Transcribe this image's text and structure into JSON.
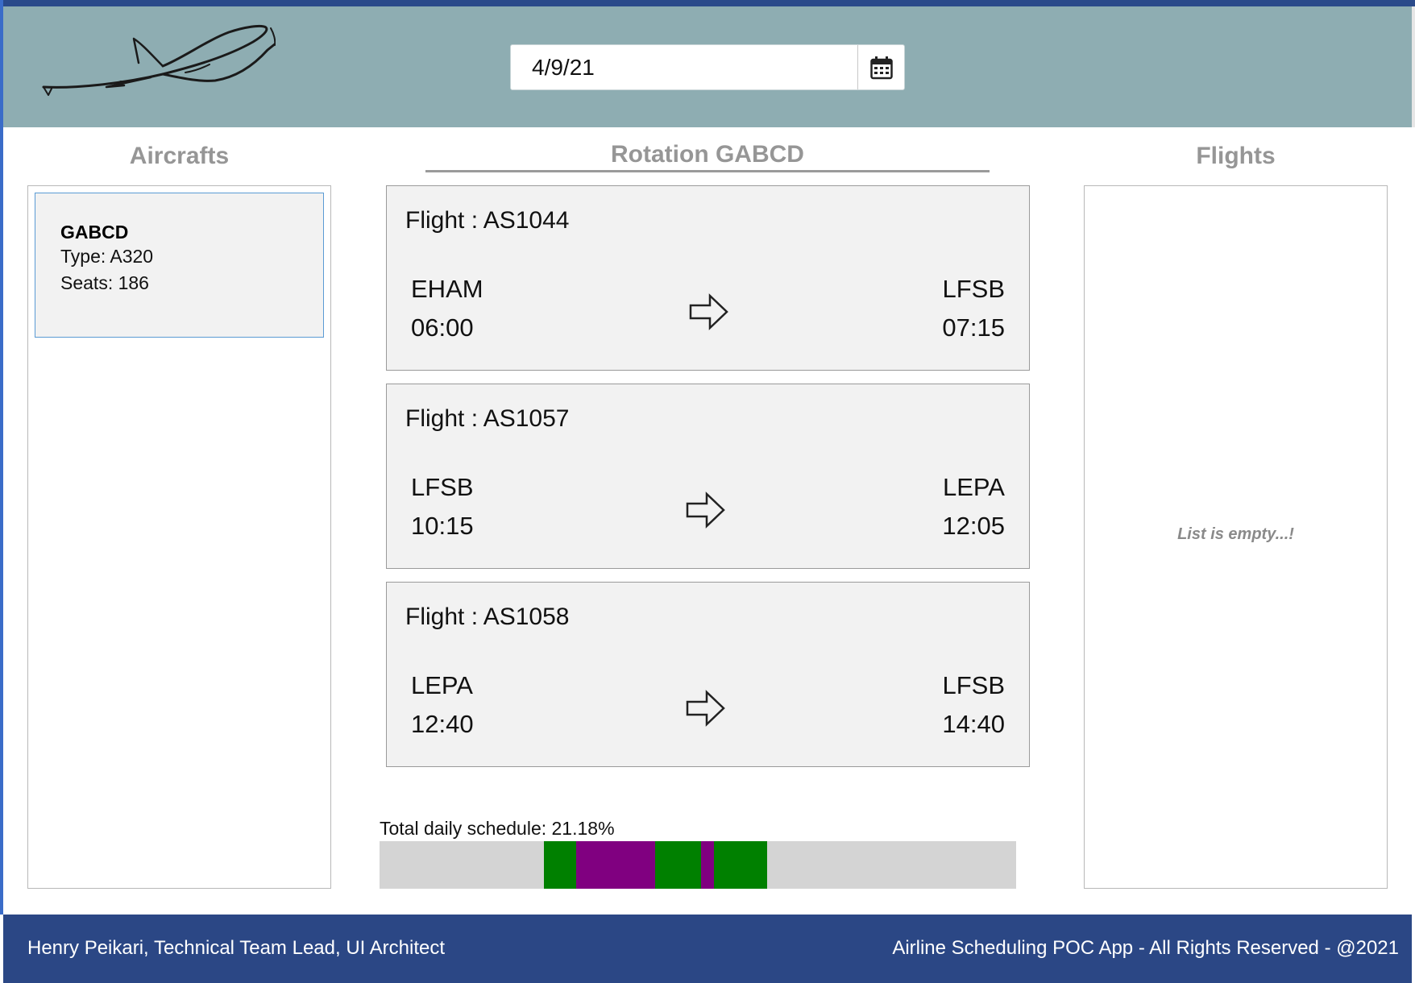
{
  "header": {
    "date_value": "4/9/21",
    "logo_icon": "airplane-logo-icon",
    "calendar_icon": "calendar-icon"
  },
  "aircrafts": {
    "title": "Aircrafts",
    "items": [
      {
        "registration": "GABCD",
        "type_text": "Type: A320",
        "seats_text": "Seats: 186"
      }
    ]
  },
  "rotation": {
    "title": "Rotation GABCD",
    "flights": [
      {
        "title": "Flight : AS1044",
        "origin": "EHAM",
        "departure": "06:00",
        "destination": "LFSB",
        "arrival": "07:15"
      },
      {
        "title": "Flight : AS1057",
        "origin": "LFSB",
        "departure": "10:15",
        "destination": "LEPA",
        "arrival": "12:05"
      },
      {
        "title": "Flight : AS1058",
        "origin": "LEPA",
        "departure": "12:40",
        "destination": "LFSB",
        "arrival": "14:40"
      }
    ],
    "arrow_icon": "right-arrow-icon"
  },
  "schedule": {
    "label": "Total daily schedule: 21.18%",
    "colors": {
      "flight": "#008000",
      "turnaround": "#800080",
      "idle": "#d4d4d4"
    }
  },
  "flights_panel": {
    "title": "Flights",
    "empty_text": "List is empty...!"
  },
  "footer": {
    "left_text": "Henry Peikari, Technical Team Lead, UI Architect",
    "right_text": "Airline Scheduling POC App - All Rights Reserved - @2021"
  }
}
